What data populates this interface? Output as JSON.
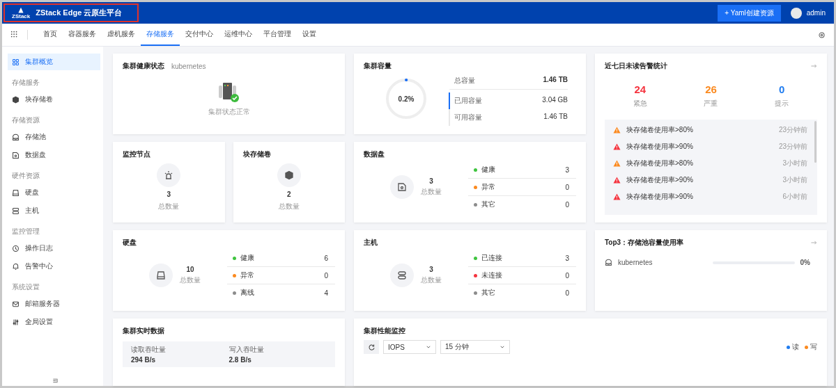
{
  "header": {
    "logo_text": "ZStack",
    "title": "ZStack Edge 云原生平台",
    "create_button": "+ Yaml创建资源",
    "user": "admin"
  },
  "nav": {
    "tabs": [
      {
        "label": "首页",
        "selected": false
      },
      {
        "label": "容器服务",
        "selected": false
      },
      {
        "label": "虚机服务",
        "selected": false
      },
      {
        "label": "存储服务",
        "selected": true
      },
      {
        "label": "交付中心",
        "selected": false
      },
      {
        "label": "运维中心",
        "selected": false
      },
      {
        "label": "平台管理",
        "selected": false
      },
      {
        "label": "设置",
        "selected": false
      }
    ]
  },
  "sidebar": {
    "sections": [
      {
        "items": [
          {
            "label": "集群概览",
            "selected": true
          }
        ]
      },
      {
        "heading": "存储服务",
        "items": [
          {
            "label": "块存储卷",
            "selected": false
          }
        ]
      },
      {
        "heading": "存储资源",
        "items": [
          {
            "label": "存储池",
            "selected": false
          },
          {
            "label": "数据盘",
            "selected": false
          }
        ]
      },
      {
        "heading": "硬件资源",
        "items": [
          {
            "label": "硬盘",
            "selected": false
          },
          {
            "label": "主机",
            "selected": false
          }
        ]
      },
      {
        "heading": "监控管理",
        "items": [
          {
            "label": "操作日志",
            "selected": false
          },
          {
            "label": "告警中心",
            "selected": false
          }
        ]
      },
      {
        "heading": "系统设置",
        "items": [
          {
            "label": "邮箱服务器",
            "selected": false
          },
          {
            "label": "全局设置",
            "selected": false
          }
        ]
      }
    ]
  },
  "health": {
    "title": "集群健康状态",
    "subtitle": "kubernetes",
    "status": "集群状态正常"
  },
  "capacity": {
    "title": "集群容量",
    "level": 0.002,
    "percent": "0.2%",
    "rows": [
      {
        "label": "总容量",
        "value": "1.46 TB"
      },
      {
        "label": "已用容量",
        "value": "3.04 GB"
      },
      {
        "label": "可用容量",
        "value": "1.46 TB"
      }
    ]
  },
  "alerts": {
    "title": "近七日未读告警统计",
    "counts": [
      {
        "value": "24",
        "label": "紧急",
        "color": "#f5343f"
      },
      {
        "value": "26",
        "label": "严重",
        "color": "#fb8a1f"
      },
      {
        "value": "0",
        "label": "提示",
        "color": "#1f7cf0"
      }
    ],
    "items": [
      {
        "text": "块存储卷使用率>80%",
        "time": "23分钟前",
        "color": "#fb8a1f"
      },
      {
        "text": "块存储卷使用率>90%",
        "time": "23分钟前",
        "color": "#f5343f"
      },
      {
        "text": "块存储卷使用率>80%",
        "time": "3小时前",
        "color": "#fb8a1f"
      },
      {
        "text": "块存储卷使用率>90%",
        "time": "3小时前",
        "color": "#f5343f"
      },
      {
        "text": "块存储卷使用率>90%",
        "time": "6小时前",
        "color": "#f5343f"
      }
    ]
  },
  "monitor_nodes": {
    "title": "监控节点",
    "count": "3",
    "count_label": "总数量"
  },
  "block_volumes": {
    "title": "块存储卷",
    "count": "2",
    "count_label": "总数量"
  },
  "data_disks": {
    "title": "数据盘",
    "count": "3",
    "count_label": "总数量",
    "statuses": [
      {
        "label": "健康",
        "value": "3",
        "color": "#3fc43f"
      },
      {
        "label": "异常",
        "value": "0",
        "color": "#fb8a1f"
      },
      {
        "label": "其它",
        "value": "0",
        "color": "#8c8c8c"
      }
    ]
  },
  "disks": {
    "title": "硬盘",
    "count": "10",
    "count_label": "总数量",
    "statuses": [
      {
        "label": "健康",
        "value": "6",
        "color": "#3fc43f"
      },
      {
        "label": "异常",
        "value": "0",
        "color": "#fb8a1f"
      },
      {
        "label": "离线",
        "value": "4",
        "color": "#8c8c8c"
      }
    ]
  },
  "hosts": {
    "title": "主机",
    "count": "3",
    "count_label": "总数量",
    "statuses": [
      {
        "label": "已连接",
        "value": "3",
        "color": "#3fc43f"
      },
      {
        "label": "未连接",
        "value": "0",
        "color": "#f5343f"
      },
      {
        "label": "其它",
        "value": "0",
        "color": "#8c8c8c"
      }
    ]
  },
  "top3": {
    "title": "Top3：存储池容量使用率",
    "items": [
      {
        "name": "kubernetes",
        "level": 0,
        "percent": "0%"
      }
    ]
  },
  "realtime": {
    "title": "集群实时数据",
    "columns": [
      "读取吞吐量",
      "写入吞吐量"
    ],
    "values": [
      "294 B/s",
      "2.8 B/s"
    ]
  },
  "performance": {
    "title": "集群性能监控",
    "metric": "IOPS",
    "range": "15 分钟",
    "legend": [
      {
        "label": "读",
        "color": "#1f7cf0"
      },
      {
        "label": "写",
        "color": "#fb8a1f"
      }
    ]
  }
}
